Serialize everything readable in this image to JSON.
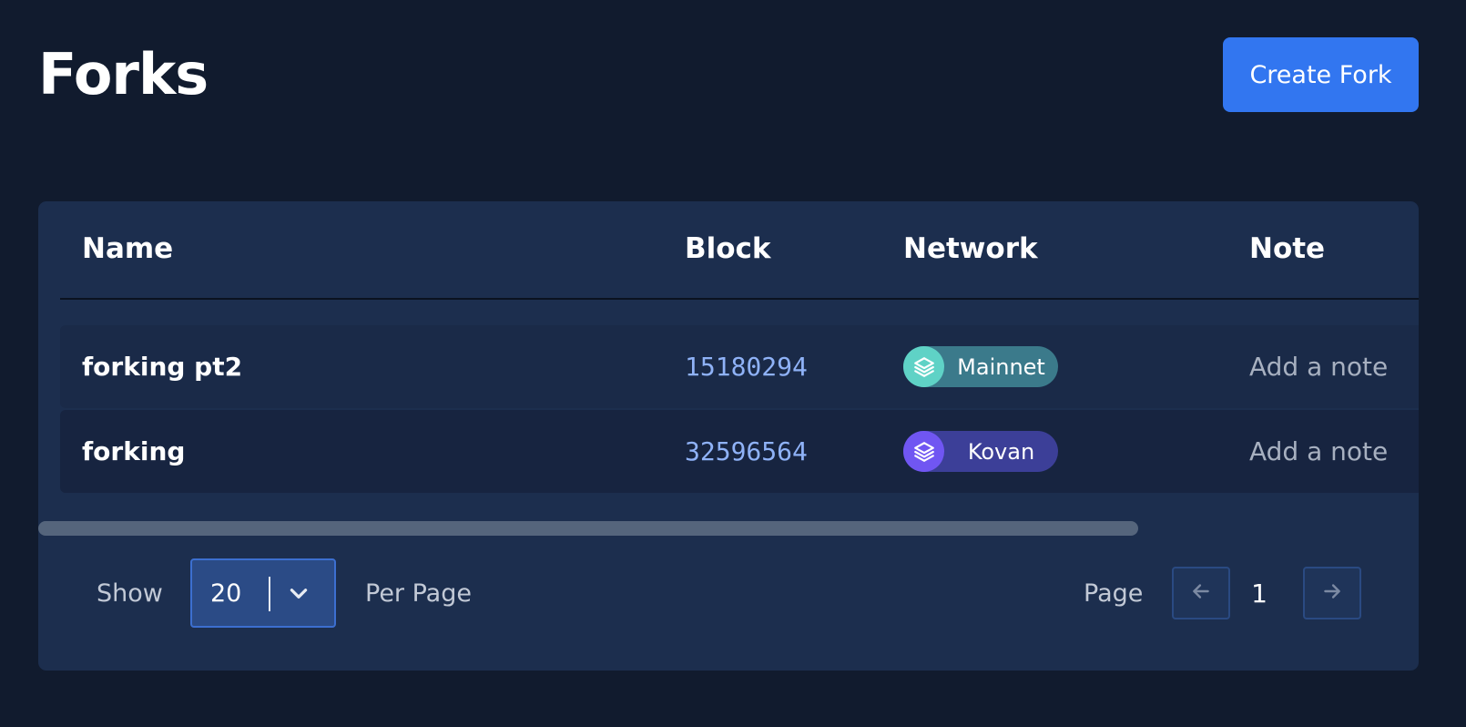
{
  "header": {
    "title": "Forks",
    "create_button_label": "Create Fork"
  },
  "table": {
    "columns": [
      "Name",
      "Block",
      "Network",
      "Note"
    ],
    "rows": [
      {
        "name": "forking pt2",
        "block": "15180294",
        "network": "Mainnet",
        "network_icon": "stack-layers-icon",
        "network_color": "#5fd2c6",
        "note": "Add a note"
      },
      {
        "name": "forking",
        "block": "32596564",
        "network": "Kovan",
        "network_icon": "stack-layers-icon",
        "network_color": "#7056f2",
        "note": "Add a note"
      }
    ]
  },
  "pagination": {
    "show_label": "Show",
    "per_page_value": "20",
    "per_page_label": "Per Page",
    "page_label": "Page",
    "current_page": "1"
  },
  "colors": {
    "background": "#111b2e",
    "card": "#1c2e4e",
    "accent": "#3276f0",
    "block_text": "#8fb2f7"
  }
}
